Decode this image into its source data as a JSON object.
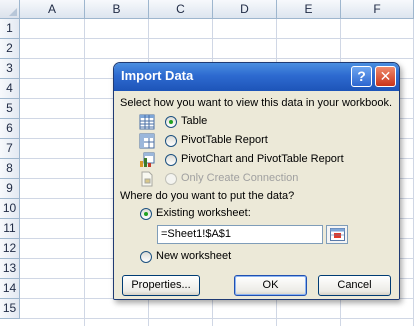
{
  "sheet": {
    "columns": [
      "A",
      "B",
      "C",
      "D",
      "E",
      "F"
    ],
    "rows": [
      "1",
      "2",
      "3",
      "4",
      "5",
      "6",
      "7",
      "8",
      "9",
      "10",
      "11",
      "12",
      "13",
      "14",
      "15"
    ]
  },
  "dialog": {
    "title": "Import Data",
    "help_glyph": "?",
    "close_glyph": "✕",
    "view_prompt": "Select how you want to view this data in your workbook.",
    "view_options": [
      {
        "label": "Table",
        "checked": true,
        "disabled": false,
        "icon": "table-icon"
      },
      {
        "label": "PivotTable Report",
        "checked": false,
        "disabled": false,
        "icon": "pivottable-icon"
      },
      {
        "label": "PivotChart and PivotTable Report",
        "checked": false,
        "disabled": false,
        "icon": "pivotchart-icon"
      },
      {
        "label": "Only Create Connection",
        "checked": false,
        "disabled": true,
        "icon": "connection-icon"
      }
    ],
    "location_prompt": "Where do you want to put the data?",
    "existing_label": "Existing worksheet:",
    "existing_checked": true,
    "range_value": "=Sheet1!$A$1",
    "new_label": "New worksheet",
    "buttons": {
      "properties": "Properties...",
      "ok": "OK",
      "cancel": "Cancel"
    }
  }
}
